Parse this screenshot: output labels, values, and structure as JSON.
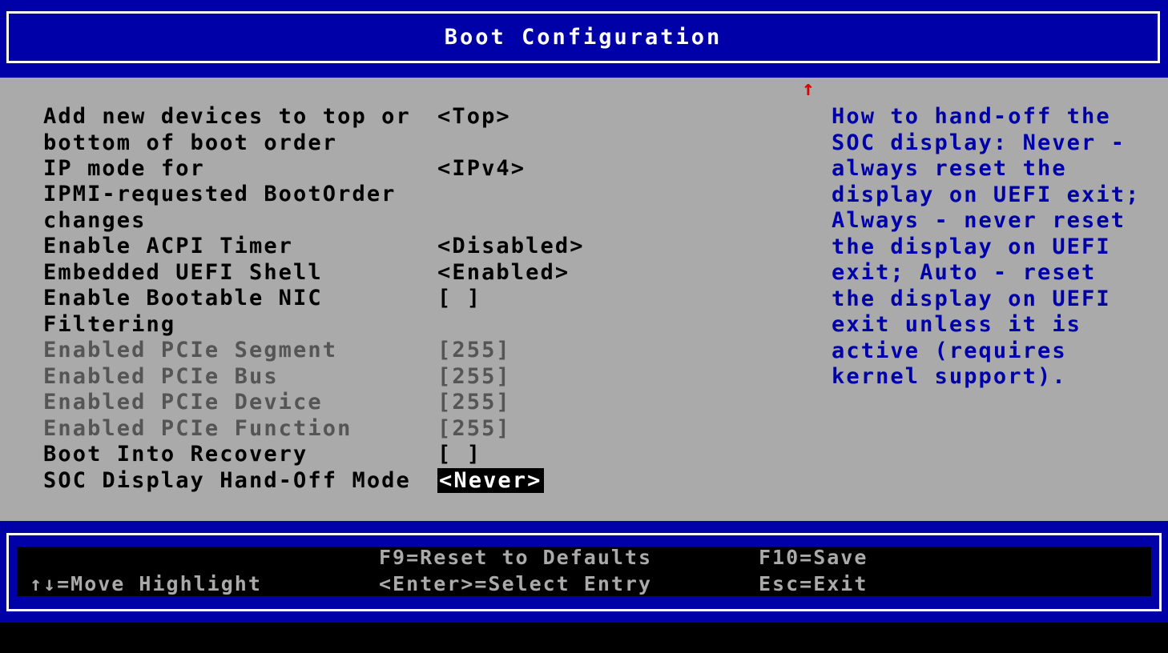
{
  "header": {
    "title": "Boot Configuration"
  },
  "scroll_indicator": "↑",
  "options": [
    {
      "label": "Add new devices to top or\nbottom of boot order",
      "value": "<Top>"
    },
    {
      "label": "IP mode for\nIPMI-requested BootOrder\nchanges",
      "value": "<IPv4>"
    },
    {
      "label": "Enable ACPI Timer",
      "value": "<Disabled>"
    },
    {
      "label": "Embedded UEFI Shell",
      "value": "<Enabled>"
    },
    {
      "label": "Enable Bootable NIC\nFiltering",
      "value": "[ ]"
    },
    {
      "label": "Enabled PCIe Segment",
      "value": "[255]"
    },
    {
      "label": "Enabled PCIe Bus",
      "value": "[255]"
    },
    {
      "label": "Enabled PCIe Device",
      "value": "[255]"
    },
    {
      "label": "Enabled PCIe Function",
      "value": "[255]"
    },
    {
      "label": "Boot Into Recovery",
      "value": "[ ]"
    },
    {
      "label": "SOC Display Hand-Off Mode",
      "value": "<Never>"
    }
  ],
  "help": "How to hand-off the\nSOC display: Never -\nalways reset the\ndisplay on UEFI exit;\nAlways - never reset\nthe display on UEFI\nexit; Auto - reset\nthe display on UEFI\nexit unless it is\nactive (requires\nkernel support).",
  "footer": {
    "move": "↑↓=Move Highlight",
    "reset": "F9=Reset to Defaults",
    "select": "<Enter>=Select Entry",
    "save": "F10=Save",
    "exit": "Esc=Exit"
  },
  "colors": {
    "band_blue": "#0000a8",
    "panel_gray": "#aaaaaa",
    "help_blue": "#0000a8",
    "disabled_text": "#555555",
    "scroll_arrow": "#e00000"
  }
}
